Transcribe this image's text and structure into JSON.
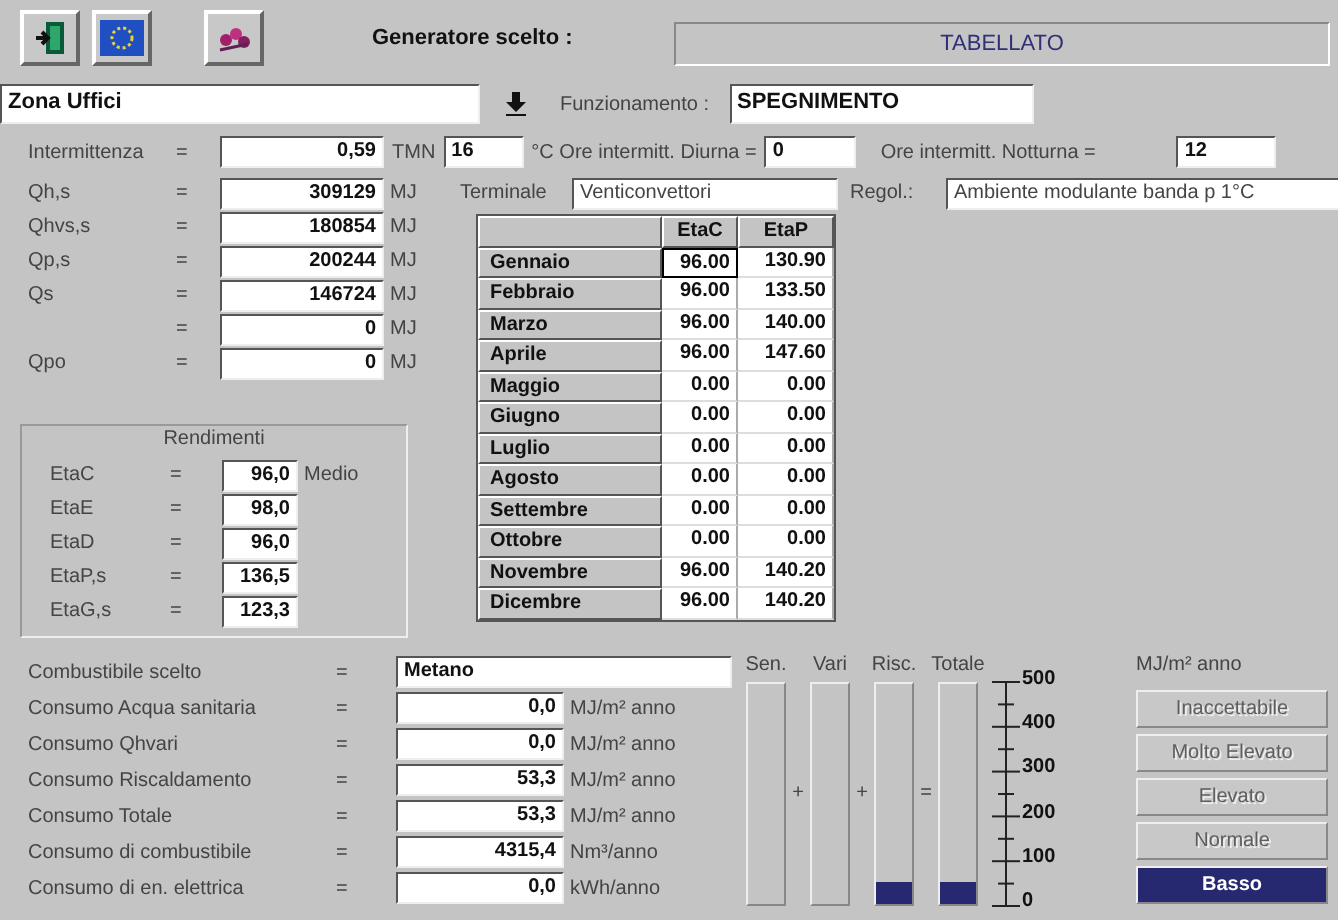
{
  "toolbar": {
    "buttons": [
      {
        "kind": "exit"
      },
      {
        "kind": "flag"
      },
      {
        "kind": "flowers"
      }
    ],
    "generator_label": "Generatore scelto :",
    "generator_value": "TABELLATO"
  },
  "zone": {
    "value": "Zona Uffici",
    "mode_label": "Funzionamento :",
    "mode_value": "SPEGNIMENTO"
  },
  "intermittence": {
    "label": "Intermittenza",
    "eq": "=",
    "value": "0,59",
    "tmn_label": "TMN",
    "tmn_value": "16",
    "day_label": "°C  Ore intermitt. Diurna =",
    "day_value": "0",
    "night_label": "Ore intermitt. Notturna =",
    "night_value": "12"
  },
  "energy_rows": [
    {
      "label": "Qh,s",
      "eq": "=",
      "value": "309129",
      "unit": "MJ"
    },
    {
      "label": "Qhvs,s",
      "eq": "=",
      "value": "180854",
      "unit": "MJ"
    },
    {
      "label": "Qp,s",
      "eq": "=",
      "value": "200244",
      "unit": "MJ"
    },
    {
      "label": "Qs",
      "eq": "=",
      "value": "146724",
      "unit": "MJ"
    },
    {
      "eq": "=",
      "value": "0",
      "unit": "MJ"
    },
    {
      "label": "Qpo",
      "eq": "=",
      "value": "0",
      "unit": "MJ"
    }
  ],
  "terminal": {
    "label": "Terminale",
    "value": "Venticonvettori",
    "reg_label": "Regol.:",
    "reg_value": "Ambiente modulante banda p 1°C"
  },
  "table": {
    "columns": [
      "EtaC",
      "EtaP"
    ],
    "rows": [
      {
        "month": "Gennaio",
        "cells": [
          "96.00",
          "130.90"
        ]
      },
      {
        "month": "Febbraio",
        "cells": [
          "96.00",
          "133.50"
        ]
      },
      {
        "month": "Marzo",
        "cells": [
          "96.00",
          "140.00"
        ]
      },
      {
        "month": "Aprile",
        "cells": [
          "96.00",
          "147.60"
        ]
      },
      {
        "month": "Maggio",
        "cells": [
          "0.00",
          "0.00"
        ]
      },
      {
        "month": "Giugno",
        "cells": [
          "0.00",
          "0.00"
        ]
      },
      {
        "month": "Luglio",
        "cells": [
          "0.00",
          "0.00"
        ]
      },
      {
        "month": "Agosto",
        "cells": [
          "0.00",
          "0.00"
        ]
      },
      {
        "month": "Settembre",
        "cells": [
          "0.00",
          "0.00"
        ]
      },
      {
        "month": "Ottobre",
        "cells": [
          "0.00",
          "0.00"
        ]
      },
      {
        "month": "Novembre",
        "cells": [
          "96.00",
          "140.20"
        ]
      },
      {
        "month": "Dicembre",
        "cells": [
          "96.00",
          "140.20"
        ]
      }
    ]
  },
  "efficiencies": {
    "title": "Rendimenti",
    "rows": [
      {
        "label": "EtaC",
        "eq": "=",
        "value": "96,0",
        "note": "Medio"
      },
      {
        "label": "EtaE",
        "eq": "=",
        "value": "98,0"
      },
      {
        "label": "EtaD",
        "eq": "=",
        "value": "96,0"
      },
      {
        "label": "EtaP,s",
        "eq": "=",
        "value": "136,5"
      },
      {
        "label": "EtaG,s",
        "eq": "=",
        "value": "123,3"
      }
    ]
  },
  "consumption": [
    {
      "kind": "text",
      "label": "Combustibile scelto",
      "eq": "=",
      "value": "Metano"
    },
    {
      "kind": "number",
      "label": "Consumo Acqua sanitaria",
      "eq": "=",
      "value": "0,0",
      "unit": "MJ/m² anno"
    },
    {
      "kind": "number",
      "label": "Consumo Qhvari",
      "eq": "=",
      "value": "0,0",
      "unit": "MJ/m² anno"
    },
    {
      "kind": "number",
      "label": "Consumo Riscaldamento",
      "eq": "=",
      "value": "53,3",
      "unit": "MJ/m² anno"
    },
    {
      "kind": "number",
      "label": "Consumo Totale",
      "eq": "=",
      "value": "53,3",
      "unit": "MJ/m² anno"
    },
    {
      "kind": "number",
      "label": "Consumo di combustibile",
      "eq": "=",
      "value": "4315,4",
      "unit": "Nm³/anno"
    },
    {
      "kind": "number",
      "label": "Consumo di en. elettrica",
      "eq": "=",
      "value": "0,0",
      "unit": "kWh/anno"
    }
  ],
  "meters": [
    {
      "label": "Sen.",
      "level": 0,
      "operator": "+"
    },
    {
      "label": "Vari",
      "level": 0,
      "operator": "+"
    },
    {
      "label": "Risc.",
      "level": 0.1,
      "operator": "="
    },
    {
      "label": "Totale",
      "level": 0.1
    }
  ],
  "scale": {
    "ticks": [
      "500",
      "400",
      "300",
      "200",
      "100",
      "0"
    ],
    "unit": "MJ/m² anno"
  },
  "ratings": [
    {
      "label": "Inaccettabile",
      "selected": false
    },
    {
      "label": "Molto Elevato",
      "selected": false
    },
    {
      "label": "Elevato",
      "selected": false
    },
    {
      "label": "Normale",
      "selected": false
    },
    {
      "label": "Basso",
      "selected": true
    }
  ]
}
